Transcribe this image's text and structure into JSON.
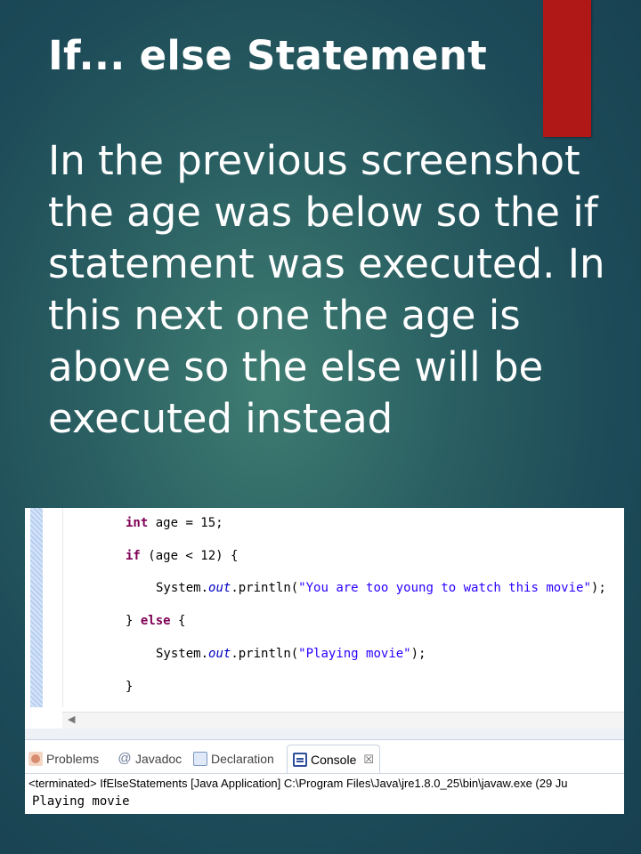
{
  "slide": {
    "title": "If... else Statement",
    "body": "In the previous screenshot the age was below so the if statement was executed. In this next one the age is above so the else will be executed instead",
    "accent_color": "#b01817"
  },
  "code": {
    "line1": {
      "kw": "int",
      "rest": " age = 15;"
    },
    "line2": {
      "kw": "if",
      "rest": " (age < 12) {"
    },
    "line3": {
      "pre": "System.",
      "field": "out",
      "mid": ".println(",
      "str": "\"You are too young to watch this movie\"",
      "post": ");"
    },
    "line4": {
      "pre": "} ",
      "kw": "else",
      "post": " {"
    },
    "line5": {
      "pre": "System.",
      "field": "out",
      "mid": ".println(",
      "str": "\"Playing movie\"",
      "post": ");"
    },
    "line6": "}"
  },
  "views": {
    "tabs": [
      {
        "label": "Problems",
        "icon": "problems-icon"
      },
      {
        "label": "Javadoc",
        "icon": "javadoc-icon"
      },
      {
        "label": "Declaration",
        "icon": "declaration-icon"
      },
      {
        "label": "Console",
        "icon": "console-icon",
        "active": true
      }
    ],
    "close_glyph": "☒"
  },
  "console": {
    "status": "<terminated> IfElseStatements [Java Application] C:\\Program Files\\Java\\jre1.8.0_25\\bin\\javaw.exe (29 Ju",
    "output": "Playing movie"
  }
}
